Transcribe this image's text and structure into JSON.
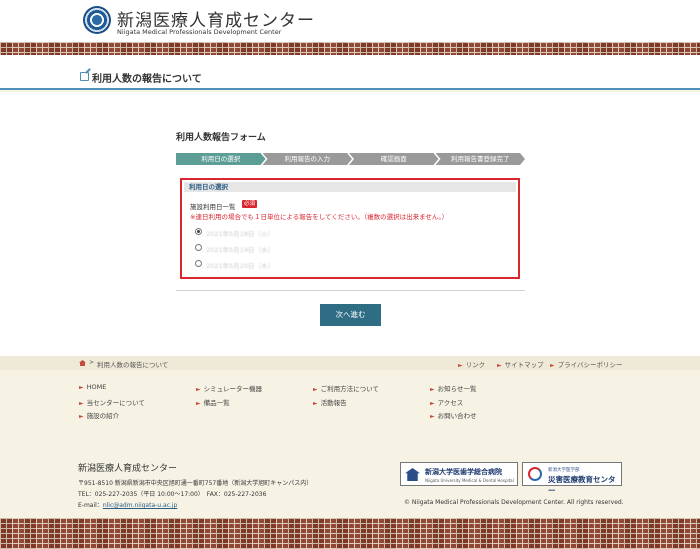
{
  "header": {
    "site_title": "新潟医療人育成センター",
    "site_subtitle": "Niigata Medical Professionals Development Center"
  },
  "page": {
    "title": "利用人数の報告について"
  },
  "form": {
    "heading": "利用人数報告フォーム",
    "steps": [
      {
        "label": "利用日の選択",
        "active": true
      },
      {
        "label": "利用報告の入力",
        "active": false
      },
      {
        "label": "確認画面",
        "active": false
      },
      {
        "label": "利用報告書登録完了",
        "active": false
      }
    ],
    "section_title": "利用日の選択",
    "field_label": "施設利用日一覧",
    "required_badge": "必須",
    "note": "※連日利用の場合でも１日単位による報告をしてください。（複数の選択は出来ません。）",
    "options": [
      {
        "label": "2021年5月18日（火）",
        "selected": true
      },
      {
        "label": "2021年5月19日（水）",
        "selected": false
      },
      {
        "label": "2021年5月20日（木）",
        "selected": false
      }
    ],
    "next_button": "次へ進む"
  },
  "breadcrumb": {
    "current": "利用人数の報告について"
  },
  "top_links": [
    "リンク",
    "サイトマップ",
    "プライバシーポリシー"
  ],
  "footer_links": {
    "col1": [
      "HOME",
      "当センターについて",
      "施設の紹介"
    ],
    "col2": [
      "シミュレーター機器",
      "備品一覧"
    ],
    "col3": [
      "ご利用方法について",
      "活動報告"
    ],
    "col4": [
      "お知らせ一覧",
      "アクセス",
      "お問い合わせ"
    ]
  },
  "footer": {
    "name": "新潟医療人育成センター",
    "address": "〒951-8510 新潟県新潟市中央区旭町通一番町757番地（新潟大学旭町キャンパス内）",
    "phone": "TEL：025-227-2035（平日 10:00〜17:00）　FAX：025-227-2036",
    "email_label": "E-mail：",
    "email": "nlic@adm.niigata-u.ac.jp",
    "partner1_name": "新潟大学医歯学総合病院",
    "partner1_sub": "Niigata University Medical & Dental Hospital",
    "partner2_sub": "新潟大学医学部",
    "partner2_name": "災害医療教育センター",
    "copyright": "© Niigata Medical Professionals Development Center. All rights reserved."
  }
}
